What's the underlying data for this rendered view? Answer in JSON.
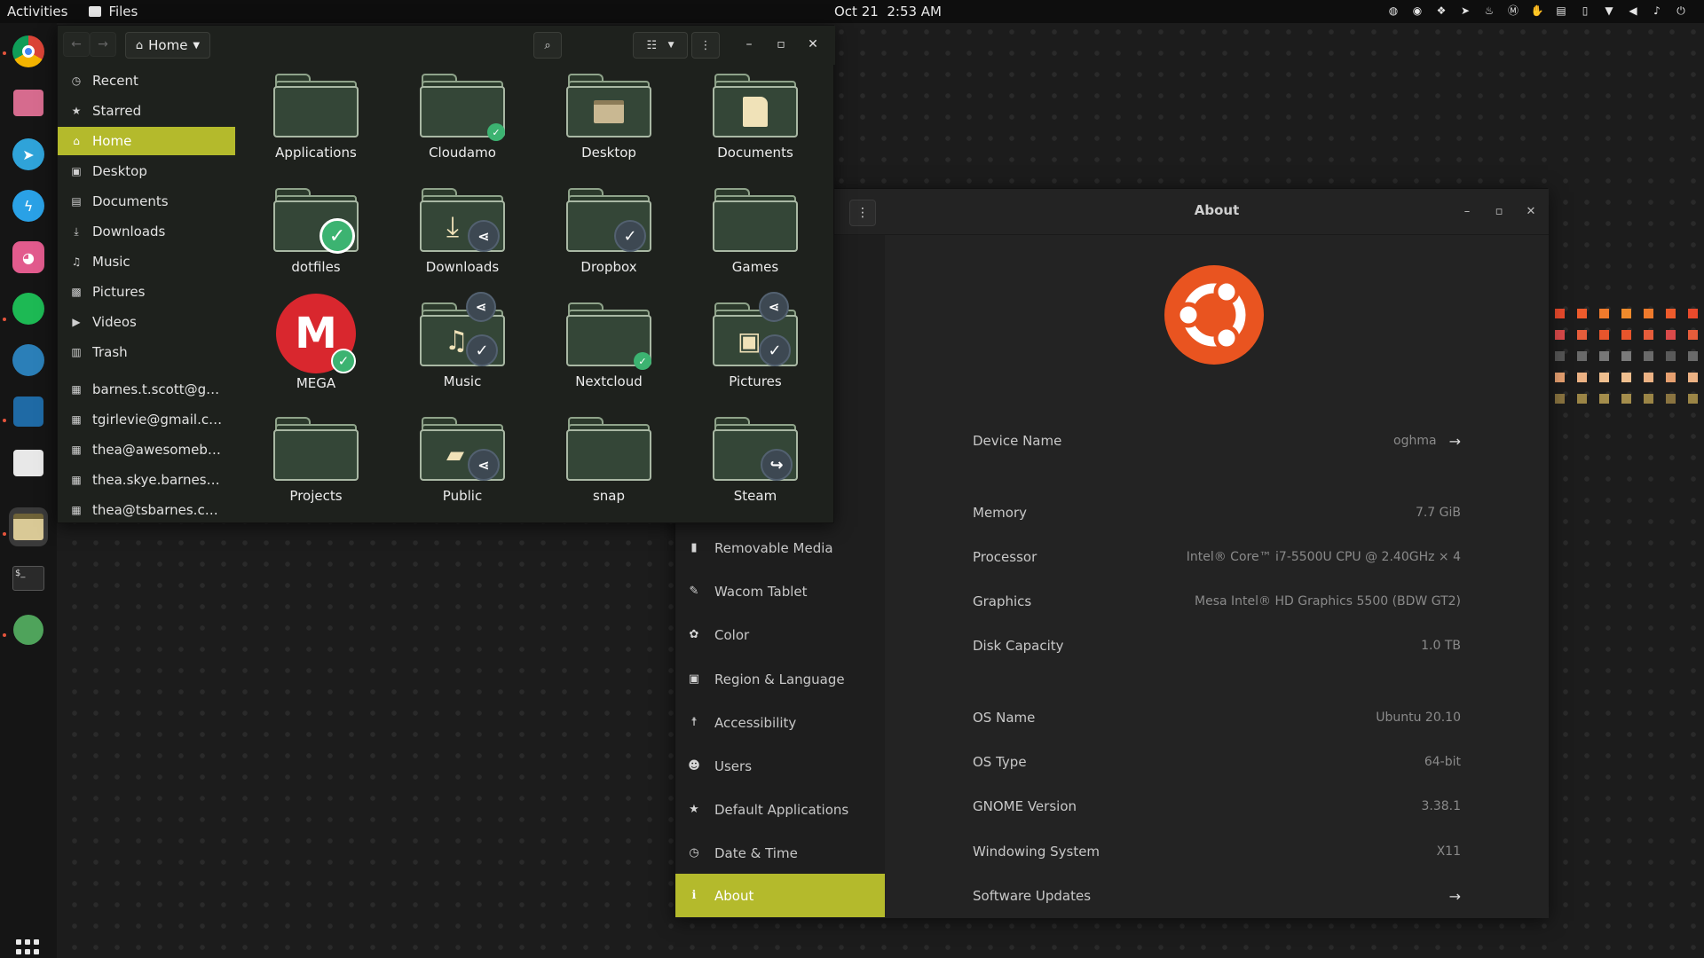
{
  "topbar": {
    "activities": "Activities",
    "app_name": "Files",
    "date": "Oct 21",
    "time": "2:53 AM"
  },
  "files_window": {
    "path_label": "Home",
    "sidebar": [
      {
        "label": "Recent",
        "icon": "clock-icon"
      },
      {
        "label": "Starred",
        "icon": "star-icon"
      },
      {
        "label": "Home",
        "icon": "home-icon",
        "active": true
      },
      {
        "label": "Desktop",
        "icon": "desktop-icon"
      },
      {
        "label": "Documents",
        "icon": "document-icon"
      },
      {
        "label": "Downloads",
        "icon": "download-icon"
      },
      {
        "label": "Music",
        "icon": "music-icon"
      },
      {
        "label": "Pictures",
        "icon": "picture-icon"
      },
      {
        "label": "Videos",
        "icon": "video-icon"
      },
      {
        "label": "Trash",
        "icon": "trash-icon"
      },
      {
        "label": "barnes.t.scott@gm...",
        "icon": "network-drive-icon"
      },
      {
        "label": "tgirlevie@gmail.com",
        "icon": "network-drive-icon"
      },
      {
        "label": "thea@awesomebar...",
        "icon": "network-drive-icon"
      },
      {
        "label": "thea.skye.barnes@g...",
        "icon": "network-drive-icon"
      },
      {
        "label": "thea@tsbarnes.com",
        "icon": "network-drive-icon"
      }
    ],
    "items": [
      {
        "label": "Applications",
        "badge": ""
      },
      {
        "label": "Cloudamo",
        "badge": "sync"
      },
      {
        "label": "Desktop",
        "badge": "",
        "glyph": "desktop"
      },
      {
        "label": "Documents",
        "badge": "",
        "glyph": "document"
      },
      {
        "label": "dotfiles",
        "badge": "check-green"
      },
      {
        "label": "Downloads",
        "badge": "share",
        "glyph": "download"
      },
      {
        "label": "Dropbox",
        "badge": "check-slate"
      },
      {
        "label": "Games",
        "badge": ""
      },
      {
        "label": "MEGA",
        "badge": "mega"
      },
      {
        "label": "Music",
        "badge": "share-check",
        "glyph": "music"
      },
      {
        "label": "Nextcloud",
        "badge": "sync"
      },
      {
        "label": "Pictures",
        "badge": "share-check",
        "glyph": "picture"
      },
      {
        "label": "Projects",
        "badge": ""
      },
      {
        "label": "Public",
        "badge": "share",
        "glyph": "public"
      },
      {
        "label": "snap",
        "badge": ""
      },
      {
        "label": "Steam",
        "badge": "link"
      }
    ]
  },
  "settings_window": {
    "title": "About",
    "nav": [
      {
        "label": "Removable Media",
        "icon": "usb-icon"
      },
      {
        "label": "Wacom Tablet",
        "icon": "tablet-icon"
      },
      {
        "label": "Color",
        "icon": "color-icon"
      },
      {
        "label": "Region & Language",
        "icon": "region-icon"
      },
      {
        "label": "Accessibility",
        "icon": "accessibility-icon"
      },
      {
        "label": "Users",
        "icon": "users-icon"
      },
      {
        "label": "Default Applications",
        "icon": "star-icon"
      },
      {
        "label": "Date & Time",
        "icon": "clock-icon"
      },
      {
        "label": "About",
        "icon": "info-icon",
        "active": true
      }
    ],
    "device_name": {
      "label": "Device Name",
      "value": "oghma"
    },
    "memory": {
      "label": "Memory",
      "value": "7.7 GiB"
    },
    "processor": {
      "label": "Processor",
      "value": "Intel® Core™ i7-5500U CPU @ 2.40GHz × 4"
    },
    "graphics": {
      "label": "Graphics",
      "value": "Mesa Intel® HD Graphics 5500 (BDW GT2)"
    },
    "disk": {
      "label": "Disk Capacity",
      "value": "1.0 TB"
    },
    "os_name": {
      "label": "OS Name",
      "value": "Ubuntu 20.10"
    },
    "os_type": {
      "label": "OS Type",
      "value": "64-bit"
    },
    "gnome": {
      "label": "GNOME Version",
      "value": "3.38.1"
    },
    "windowing": {
      "label": "Windowing System",
      "value": "X11"
    },
    "updates": {
      "label": "Software Updates",
      "value": ""
    }
  },
  "colors": {
    "accent": "#b4ba2c",
    "ubuntu_orange": "#e95420"
  }
}
